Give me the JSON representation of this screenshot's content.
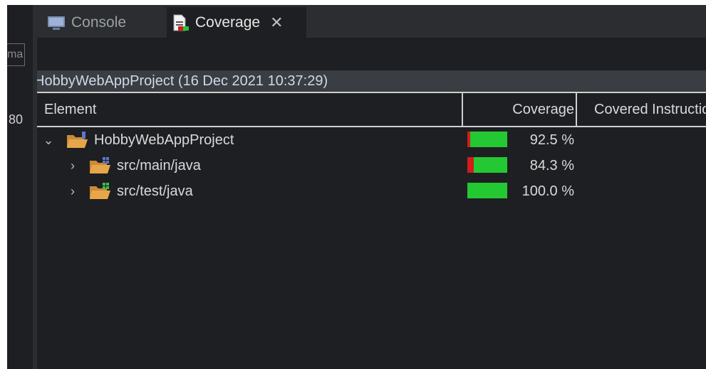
{
  "left_panel": {
    "input_text": "ma",
    "number": "80"
  },
  "tabs": [
    {
      "label": "Console",
      "active": false
    },
    {
      "label": "Coverage",
      "active": true,
      "close": "✕"
    }
  ],
  "session": {
    "title": "HobbyWebAppProject (16 Dec 2021 10:37:29)"
  },
  "columns": {
    "element": "Element",
    "coverage": "Coverage",
    "covered": "Covered Instructions"
  },
  "rows": [
    {
      "toggle": "⌄",
      "label": "HobbyWebAppProject",
      "coverage": "92.5 %",
      "coverage_ratio": 0.925,
      "icon": "project-folder-icon"
    },
    {
      "toggle": "›",
      "label": "src/main/java",
      "coverage": "84.3 %",
      "coverage_ratio": 0.843,
      "icon": "source-folder-icon"
    },
    {
      "toggle": "›",
      "label": "src/test/java",
      "coverage": "100.0 %",
      "coverage_ratio": 1.0,
      "icon": "test-source-folder-icon"
    }
  ],
  "colors": {
    "covered": "#24c832",
    "missed": "#d11c1c",
    "background": "#1e1f22"
  }
}
